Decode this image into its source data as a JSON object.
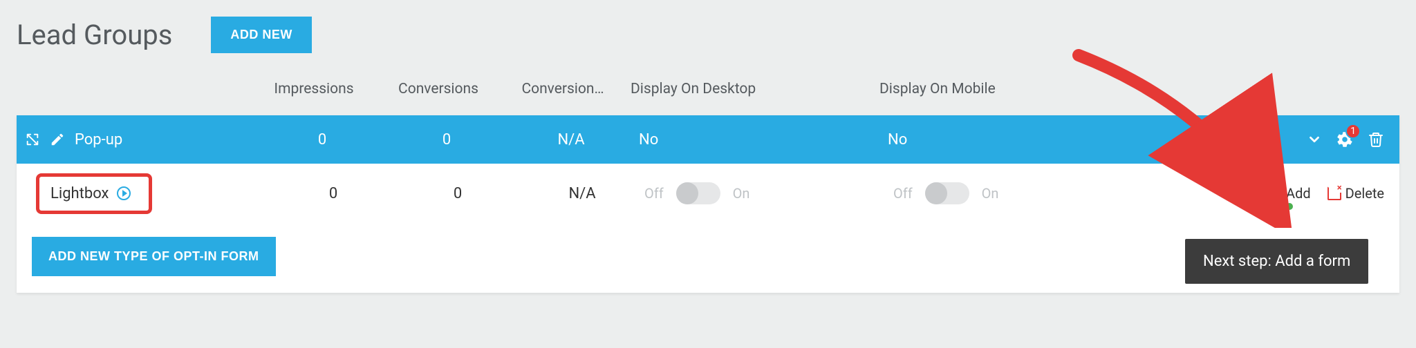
{
  "header": {
    "title": "Lead Groups",
    "add_new": "ADD NEW"
  },
  "columns": {
    "impressions": "Impressions",
    "conversions": "Conversions",
    "conversion_rate": "Conversion…",
    "display_desktop": "Display On Desktop",
    "display_mobile": "Display On Mobile"
  },
  "group": {
    "name": "Pop-up",
    "impressions": "0",
    "conversions": "0",
    "conversion_rate": "N/A",
    "display_desktop": "No",
    "display_mobile": "No",
    "badge_count": "1"
  },
  "item": {
    "name": "Lightbox",
    "impressions": "0",
    "conversions": "0",
    "conversion_rate": "N/A",
    "toggle_off": "Off",
    "toggle_on": "On",
    "add_label": "Add",
    "delete_label": "Delete"
  },
  "footer": {
    "add_optin": "ADD NEW TYPE OF OPT-IN FORM"
  },
  "tooltip": {
    "next_step": "Next step: Add a form"
  }
}
